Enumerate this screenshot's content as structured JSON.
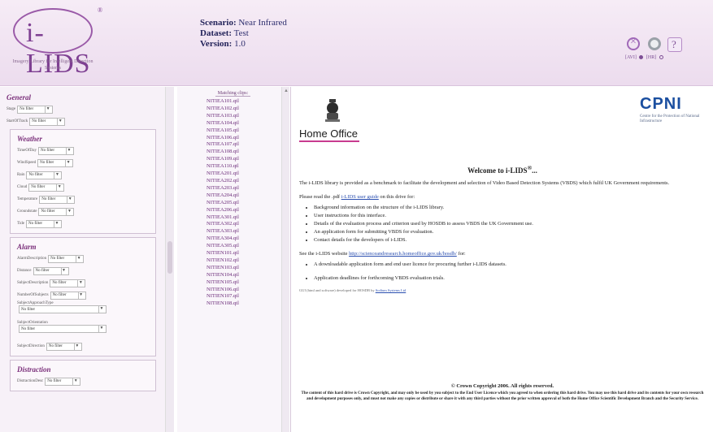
{
  "header": {
    "logo_text": "i-LIDS",
    "logo_tagline": "Imagery Library for Intelligent Detection Systems",
    "scenario_label": "Scenario:",
    "scenario_value": "Near Infrared",
    "dataset_label": "Dataset:",
    "dataset_value": "Test",
    "version_label": "Version:",
    "version_value": "1.0",
    "res_option_1": "[AVI]",
    "res_option_2": "[HR]"
  },
  "filters": {
    "general_title": "General",
    "general": [
      {
        "label": "Stage",
        "value": "No filter"
      },
      {
        "label": "StartOfTrack",
        "value": "No filter"
      }
    ],
    "weather_title": "Weather",
    "weather": [
      {
        "label": "TimeOfDay",
        "value": "No filter"
      },
      {
        "label": "WindSpeed",
        "value": "No filter"
      },
      {
        "label": "Rain",
        "value": "No filter"
      },
      {
        "label": "Cloud",
        "value": "No filter"
      },
      {
        "label": "Temperature",
        "value": "No filter"
      },
      {
        "label": "Groundstate",
        "value": "No filter"
      },
      {
        "label": "Tide",
        "value": "No filter"
      }
    ],
    "alarm_title": "Alarm",
    "alarm": [
      {
        "label": "AlarmDescription",
        "value": "No filter"
      },
      {
        "label": "Distance",
        "value": "No filter"
      },
      {
        "label": "SubjectDescription",
        "value": "No filter"
      },
      {
        "label": "NumberOfSubjects",
        "value": "No filter"
      }
    ],
    "alarm_stacked": [
      {
        "label": "SubjectApproachType",
        "value": "No filter"
      },
      {
        "label": "SubjectOrientation",
        "value": "No filter"
      }
    ],
    "alarm_last": {
      "label": "SubjectDirection",
      "value": "No filter"
    },
    "distraction_title": "Distraction",
    "distraction": [
      {
        "label": "DistractionDesc",
        "value": "No filter"
      }
    ]
  },
  "clips": {
    "title": "Matching clips:",
    "items": [
      "NITIEA101.qtl",
      "NITIEA102.qtl",
      "NITIEA103.qtl",
      "NITIEA104.qtl",
      "NITIEA105.qtl",
      "NITIEA106.qtl",
      "NITIEA107.qtl",
      "NITIEA108.qtl",
      "NITIEA109.qtl",
      "NITIEA110.qtl",
      "NITIEA201.qtl",
      "NITIEA202.qtl",
      "NITIEA203.qtl",
      "NITIEA204.qtl",
      "NITIEA205.qtl",
      "NITIEA206.qtl",
      "NITIEA301.qtl",
      "NITIEA302.qtl",
      "NITIEA303.qtl",
      "NITIEA304.qtl",
      "NITIEA305.qtl",
      "NITIEN101.qtl",
      "NITIEN102.qtl",
      "NITIEN103.qtl",
      "NITIEN104.qtl",
      "NITIEN105.qtl",
      "NITIEN106.qtl",
      "NITIEN107.qtl",
      "NITIEN108.qtl"
    ]
  },
  "welcome": {
    "home_office": "Home Office",
    "cpni_logo": "CPNI",
    "cpni_sub": "Centre for the Protection of National Infrastructure",
    "title_main": "Welcome to i-LIDS",
    "title_reg": "®",
    "title_end": "...",
    "intro": "The i-LIDS library is provided as a benchmark to facilitate the development and selection of Video Based Detection Systems (VBDS) which fulfil UK Government requirements.",
    "read_prefix": "Please read the .pdf",
    "read_link": "i-LIDS user guide",
    "read_suffix": "on this drive for:",
    "read_items": [
      "Background information on the structure of the i-LIDS library.",
      "User instructions for this interface.",
      "Details of the evaluation process and criterion used by HOSDB to assess VBDS the UK Government use.",
      "An application form for submitting VBDS for evaluation.",
      "Contact details for the developers of i-LIDS."
    ],
    "see_prefix": "See the i-LIDS website",
    "see_link": "http://scienceandresearch.homeoffice.gov.uk/hosdb/",
    "see_suffix": "for:",
    "see_items": [
      "A downloadable application form and end user licence for procuring further i-LIDS datasets.",
      "Application deadlines for forthcoming VBDS evaluation trials."
    ],
    "note_prefix": "GUI (html and software) developed for HOSDB by",
    "note_link": "Sodium Systems Ltd",
    "copyright": "© Crown Copyright 2006. All rights reserved.",
    "legal": "The content of this hard drive is Crown Copyright, and may only be used by you subject to the End User Licence which you agreed to when ordering this hard drive. You may use this hard drive and its contents for your own research and development purposes only, and must not make any copies or distribute or share it with any third parties without the prior written approval of both the Home Office Scientific Development Branch and the Security Service."
  }
}
